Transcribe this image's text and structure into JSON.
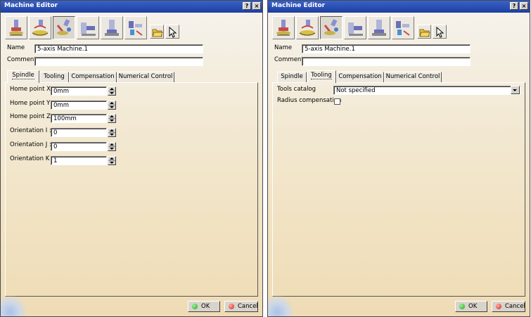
{
  "left_window": {
    "title": "Machine Editor",
    "name_label": "Name",
    "name_value": "5-axis Machine.1",
    "comment_label": "Comment",
    "comment_value": "",
    "tabs": [
      "Spindle",
      "Tooling",
      "Compensation",
      "Numerical Control"
    ],
    "active_tab": "Spindle",
    "fields": [
      {
        "label": "Home point X :",
        "value": "0mm"
      },
      {
        "label": "Home point Y :",
        "value": "0mm"
      },
      {
        "label": "Home point Z :",
        "value": "100mm"
      },
      {
        "label": "Orientation I :",
        "value": "0"
      },
      {
        "label": "Orientation J :",
        "value": "0"
      },
      {
        "label": "Orientation K :",
        "value": "1"
      }
    ],
    "ok_label": "OK",
    "cancel_label": "Cancel"
  },
  "right_window": {
    "title": "Machine Editor",
    "name_label": "Name",
    "name_value": "5-axis Machine.1",
    "comment_label": "Comment",
    "comment_value": "",
    "tabs": [
      "Spindle",
      "Tooling",
      "Compensation",
      "Numerical Control"
    ],
    "active_tab": "Tooling",
    "tools_catalog_label": "Tools catalog",
    "tools_catalog_value": "Not specified",
    "radius_comp_label": "Radius compensation",
    "radius_comp_checked": false,
    "ok_label": "OK",
    "cancel_label": "Cancel"
  },
  "titlebar_buttons": {
    "help": "?",
    "close": "×"
  },
  "toolbar_icons": [
    "3-axis-machine-icon",
    "3-axis-rotary-table-icon",
    "5-axis-machine-icon",
    "horizontal-lathe-icon",
    "vertical-lathe-icon",
    "multi-slide-lathe-icon",
    "open-folder-icon",
    "select-cursor-icon"
  ],
  "colors": {
    "title_bar": "#1d3fa0",
    "ok_green": "#1aa31a",
    "cancel_red": "#d42020"
  }
}
